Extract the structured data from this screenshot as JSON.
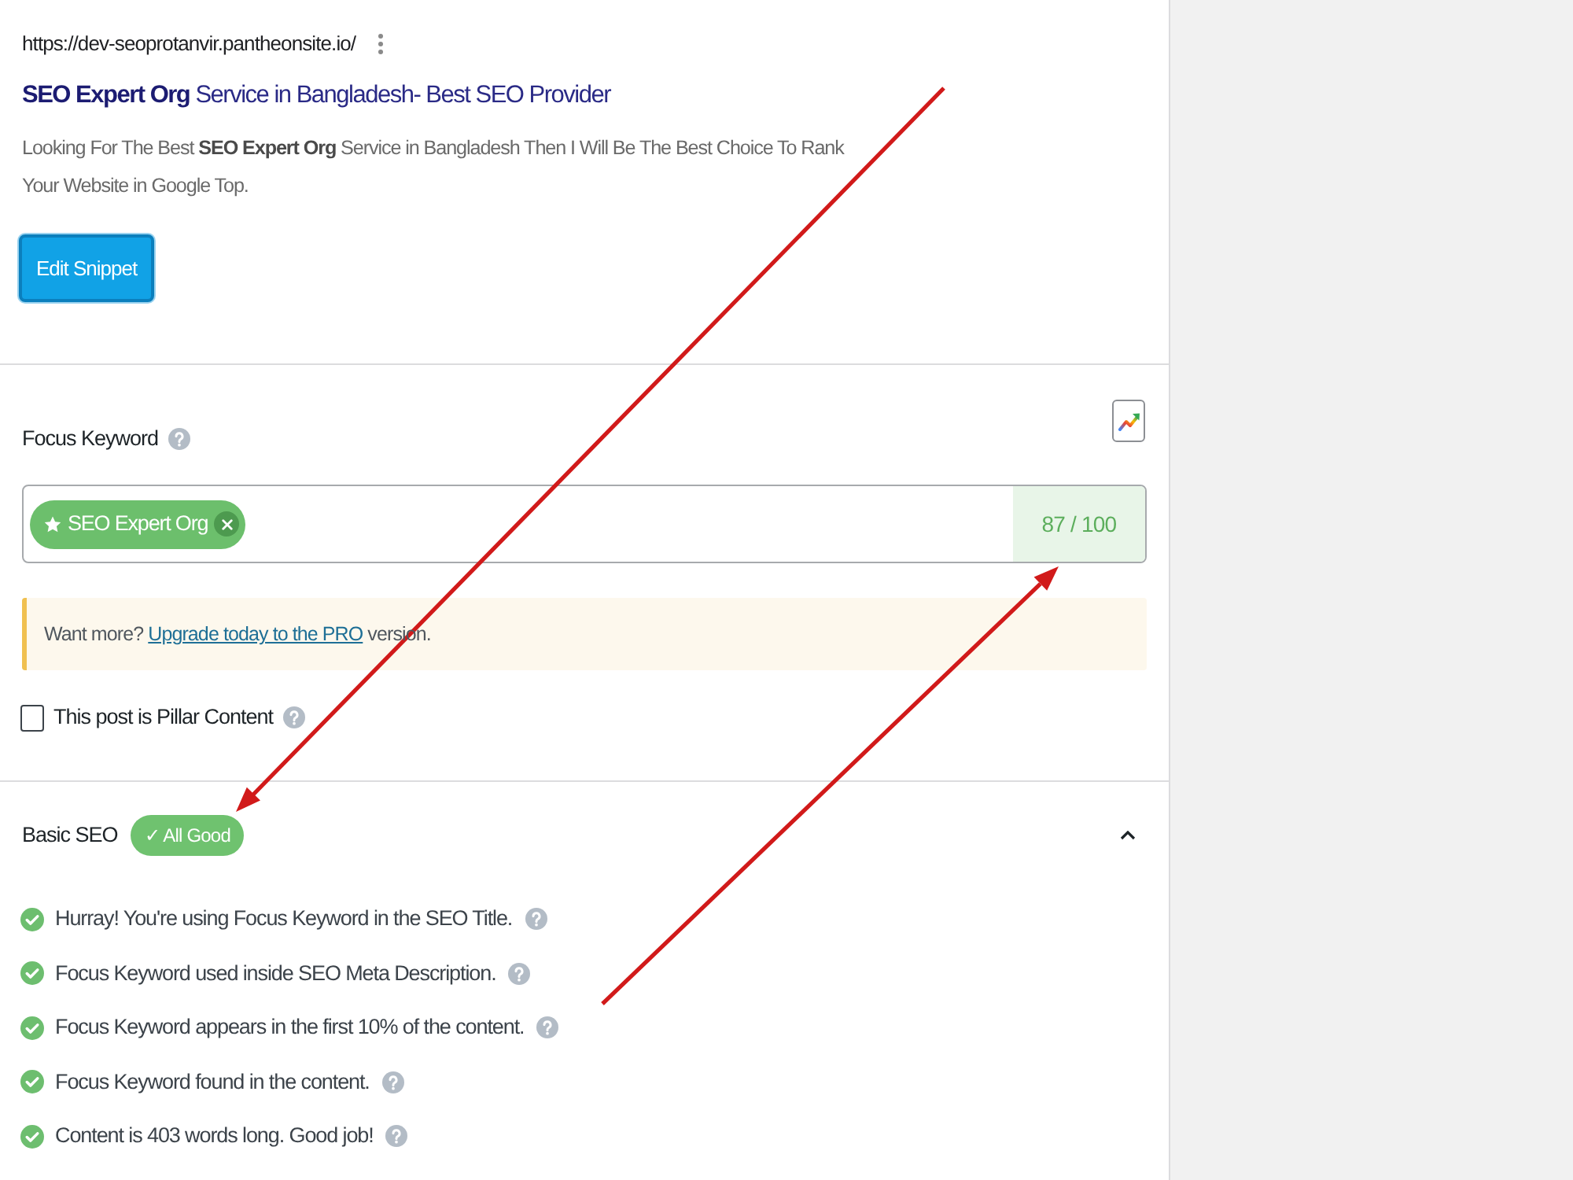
{
  "snippet_preview": {
    "url": "https://dev-seoprotanvir.pantheonsite.io/",
    "title": "**SEO Expert Org** Service in Bangladesh- Best SEO Provider",
    "description": "Looking For The Best **SEO Expert Org** Service in Bangladesh Then I Will Be The Best Choice To Rank Your Website in Google Top.",
    "edit_button": "Edit Snippet"
  },
  "focus_keyword": {
    "label": "Focus Keyword",
    "keywords": [
      {
        "text": "SEO Expert Org"
      }
    ],
    "score": "87 / 100"
  },
  "notice": {
    "before": "Want more?",
    "link": "Upgrade today to the PRO",
    "after": "version."
  },
  "pillar_content": {
    "label": "This post is Pillar Content",
    "checked": false
  },
  "basic_seo": {
    "title": "Basic SEO",
    "badge": "✓ All Good",
    "expanded": true,
    "checks": [
      {
        "text": "Hurray! You're using Focus Keyword in the SEO Title.",
        "passed": true
      },
      {
        "text": "Focus Keyword used inside SEO Meta Description.",
        "passed": true
      },
      {
        "text": "Focus Keyword appears in the first 10% of the content.",
        "passed": true
      },
      {
        "text": "Focus Keyword found in the content.",
        "passed": true
      },
      {
        "text": "Content is 403 words long. Good job!",
        "passed": true
      }
    ]
  }
}
